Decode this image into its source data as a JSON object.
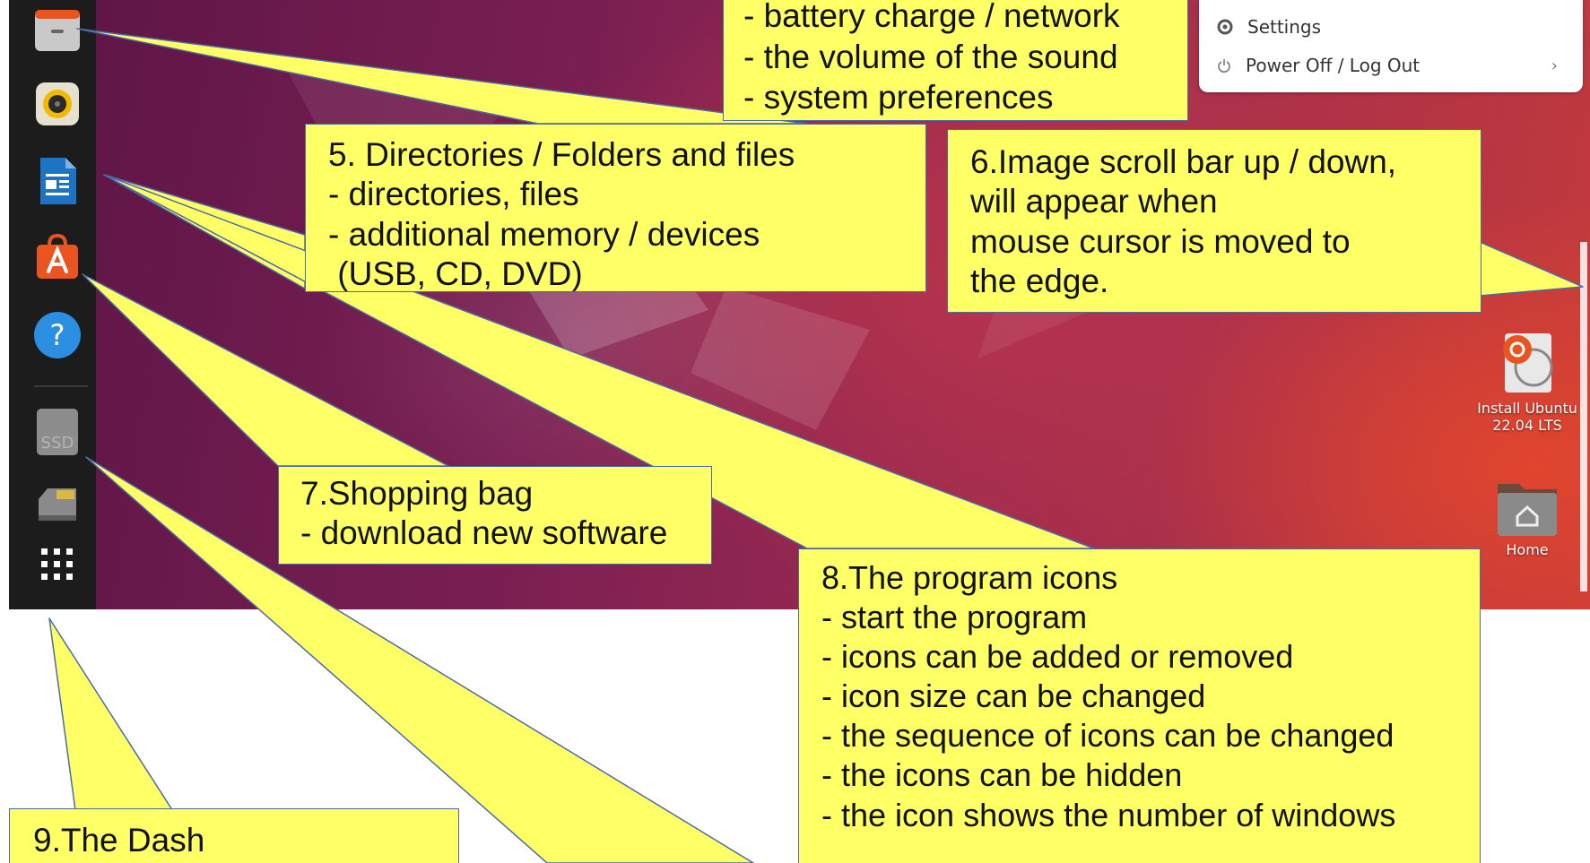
{
  "menu": {
    "settings_label": "Settings",
    "power_label": "Power Off / Log Out",
    "power_chevron": "›",
    "settings_icon": "gear-icon",
    "power_icon": "power-icon"
  },
  "dock": {
    "items": [
      {
        "name": "files",
        "icon": "files-icon"
      },
      {
        "name": "rhythmbox",
        "icon": "speaker-icon"
      },
      {
        "name": "writer",
        "icon": "document-icon"
      },
      {
        "name": "software",
        "icon": "shopping-bag-icon"
      },
      {
        "name": "help",
        "icon": "help-icon"
      },
      {
        "name": "ssd",
        "icon": "ssd-drive-icon",
        "label": "SSD"
      },
      {
        "name": "usb",
        "icon": "usb-drive-icon"
      },
      {
        "name": "apps",
        "icon": "app-grid-icon"
      }
    ]
  },
  "desktop_icons": {
    "installer_line1": "Install Ubuntu",
    "installer_line2": "22.04 LTS",
    "home_label": "Home"
  },
  "callouts": {
    "top": {
      "lines": [
        "- battery charge / network",
        "- the volume of the sound",
        "- system preferences"
      ]
    },
    "c5": {
      "lines": [
        "5. Directories / Folders and files",
        "- directories, files",
        "- additional memory / devices",
        " (USB, CD, DVD)"
      ]
    },
    "c6": {
      "lines": [
        "6.Image scroll bar up / down,",
        "will appear when",
        "mouse cursor is moved to",
        "the edge."
      ]
    },
    "c7": {
      "lines": [
        "7.Shopping bag",
        "- download new software"
      ]
    },
    "c8": {
      "lines": [
        "8.The program icons",
        "- start the program",
        "- icons can be added or removed",
        "- icon size can be changed",
        "- the sequence of icons can be changed",
        "- the icons can be hidden",
        "- the icon shows the number of windows"
      ]
    },
    "c9": {
      "lines": [
        "9.The Dash"
      ]
    }
  },
  "colors": {
    "callout_fill": "#ffff66",
    "callout_border": "#4d6aa8",
    "dock_bg": "#1c1c1c",
    "ubuntu_orange": "#e95420"
  }
}
